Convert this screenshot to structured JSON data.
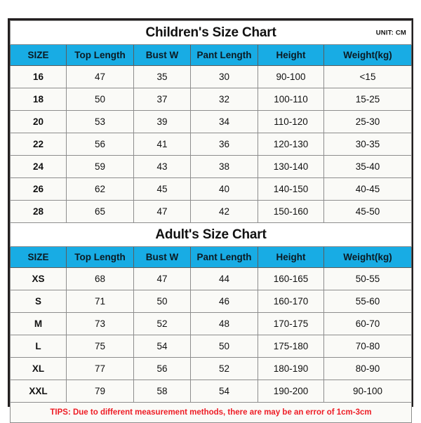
{
  "document": {
    "unit_label": "UNIT: CM",
    "accent_header_color": "#18ace4",
    "tips_color": "#ee1c25",
    "border_color": "#231f20"
  },
  "children_chart": {
    "title": "Children's Size Chart",
    "unit": "UNIT: CM",
    "columns": [
      "SIZE",
      "Top Length",
      "Bust W",
      "Pant Length",
      "Height",
      "Weight(kg)"
    ],
    "rows": [
      [
        "16",
        "47",
        "35",
        "30",
        "90-100",
        "<15"
      ],
      [
        "18",
        "50",
        "37",
        "32",
        "100-110",
        "15-25"
      ],
      [
        "20",
        "53",
        "39",
        "34",
        "110-120",
        "25-30"
      ],
      [
        "22",
        "56",
        "41",
        "36",
        "120-130",
        "30-35"
      ],
      [
        "24",
        "59",
        "43",
        "38",
        "130-140",
        "35-40"
      ],
      [
        "26",
        "62",
        "45",
        "40",
        "140-150",
        "40-45"
      ],
      [
        "28",
        "65",
        "47",
        "42",
        "150-160",
        "45-50"
      ]
    ]
  },
  "adult_chart": {
    "title": "Adult's Size Chart",
    "columns": [
      "SIZE",
      "Top Length",
      "Bust W",
      "Pant Length",
      "Height",
      "Weight(kg)"
    ],
    "rows": [
      [
        "XS",
        "68",
        "47",
        "44",
        "160-165",
        "50-55"
      ],
      [
        "S",
        "71",
        "50",
        "46",
        "160-170",
        "55-60"
      ],
      [
        "M",
        "73",
        "52",
        "48",
        "170-175",
        "60-70"
      ],
      [
        "L",
        "75",
        "54",
        "50",
        "175-180",
        "70-80"
      ],
      [
        "XL",
        "77",
        "56",
        "52",
        "180-190",
        "80-90"
      ],
      [
        "XXL",
        "79",
        "58",
        "54",
        "190-200",
        "90-100"
      ]
    ]
  },
  "footer": {
    "tips": "TIPS: Due to different measurement methods, there are may be an error of 1cm-3cm"
  }
}
